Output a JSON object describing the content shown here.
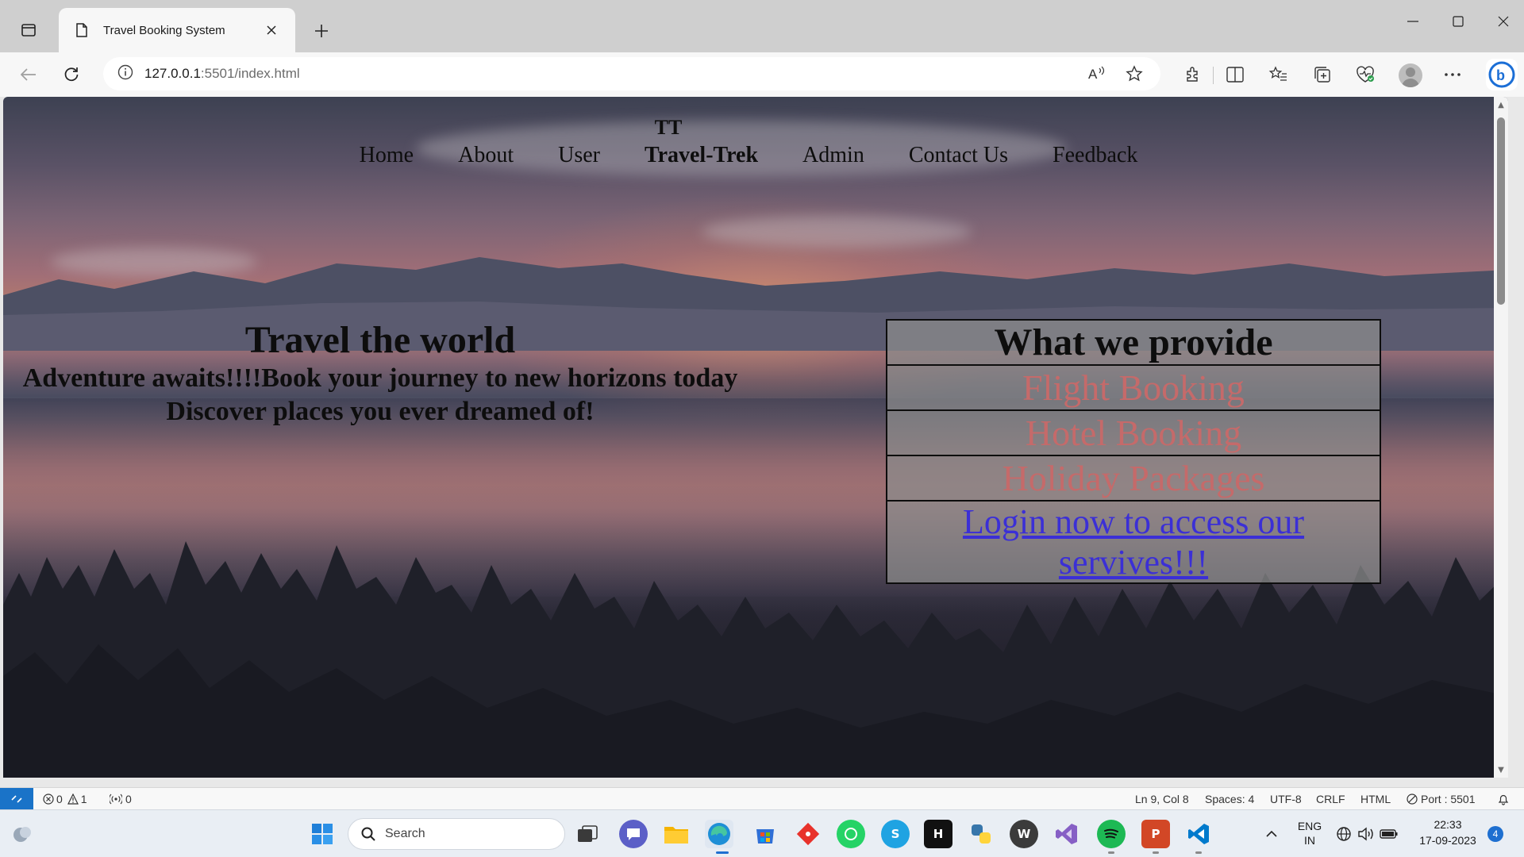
{
  "browser": {
    "tab_title": "Travel Booking System",
    "url_host": "127.0.0.1",
    "url_rest": ":5501/index.html",
    "icons": [
      "tab-actions-icon",
      "page-icon",
      "close-icon",
      "plus-icon",
      "minimize-icon",
      "maximize-icon",
      "window-close-icon",
      "back-icon",
      "refresh-icon",
      "info-icon",
      "read-aloud-icon",
      "favorite-star-icon",
      "extensions-icon",
      "split-screen-icon",
      "favorites-icon",
      "collections-icon",
      "browser-essentials-icon",
      "profile-icon",
      "more-icon",
      "copilot-icon"
    ]
  },
  "page": {
    "brand_mark": "TT",
    "nav": [
      "Home",
      "About",
      "User",
      "Travel-Trek",
      "Admin",
      "Contact Us",
      "Feedback"
    ],
    "hero": {
      "title": "Travel the world",
      "tagline": "Adventure awaits!!!!Book your journey to new horizons today",
      "subline": "Discover places you ever dreamed of!"
    },
    "services": {
      "heading": "What we provide",
      "items": [
        "Flight Booking",
        "Hotel Booking",
        "Holiday Packages"
      ],
      "login_link": "Login now to access our servives!!!"
    },
    "colors": {
      "service_text": "#c56a6a",
      "link": "#3b2fd6"
    }
  },
  "statusbar": {
    "errors": "0",
    "warnings": "1",
    "ports_forwarded": "0",
    "cursor": "Ln 9, Col 8",
    "spaces": "Spaces: 4",
    "encoding": "UTF-8",
    "eol": "CRLF",
    "language": "HTML",
    "port": "Port : 5501"
  },
  "taskbar": {
    "search_label": "Search",
    "language": "ENG",
    "region": "IN",
    "time": "22:33",
    "date": "17-09-2023",
    "notification_count": "4",
    "apps": [
      "windows-start-icon",
      "search-icon",
      "task-view-icon",
      "teams-chat-icon",
      "file-explorer-icon",
      "edge-icon",
      "store-icon",
      "git-icon",
      "whatsapp-icon",
      "skype-icon",
      "hackerrank-icon",
      "python-icon",
      "wordpress-icon",
      "visual-studio-icon",
      "spotify-icon",
      "powerpoint-icon",
      "vscode-icon"
    ]
  }
}
